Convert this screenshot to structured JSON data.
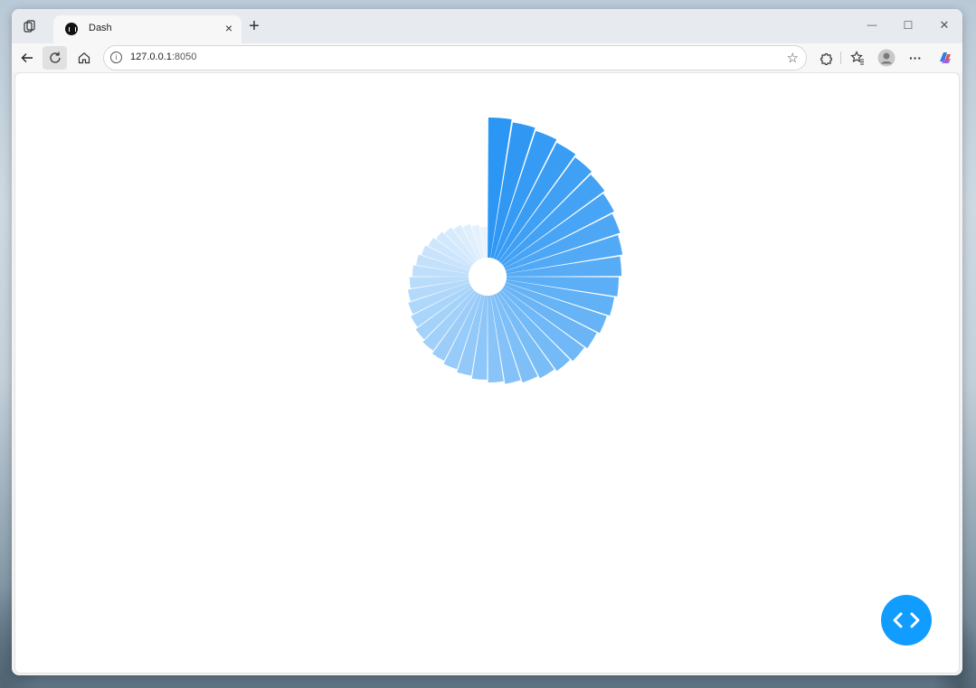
{
  "browser": {
    "tab": {
      "title": "Dash",
      "close_symbol": "×",
      "favicon": "dash-logo-icon"
    },
    "new_tab_symbol": "+",
    "window_controls": {
      "minimize": "—",
      "maximize": "☐",
      "close": "✕"
    },
    "address": {
      "host": "127.0.0.1",
      "port": ":8050"
    },
    "icons": [
      "workspaces-icon",
      "back-arrow-icon",
      "refresh-icon",
      "home-icon",
      "info-icon",
      "star-icon",
      "extensions-icon",
      "favorites-icon",
      "profile-avatar-icon",
      "more-icon",
      "copilot-icon"
    ]
  },
  "app": {
    "debug_button_icon": "code-brackets-icon",
    "accent": "#119dff"
  },
  "chart_data": {
    "type": "bar",
    "subtype": "polar-bar",
    "title": "",
    "angular_direction": "clockwise",
    "start_angle_deg": 90,
    "n_bars": 40,
    "radial_range": [
      0,
      100
    ],
    "hole": 0.12,
    "showlegend": false,
    "angular_axis_visible": false,
    "radial_axis_visible": false,
    "values": [
      100,
      98,
      96,
      94,
      92,
      90,
      88,
      86,
      84,
      82,
      80,
      78,
      76,
      74,
      72,
      70,
      68,
      66,
      64,
      62,
      60,
      58,
      56,
      54,
      52,
      50,
      48,
      46,
      44,
      42,
      40,
      38,
      36,
      34,
      32,
      30,
      28,
      26,
      24,
      22
    ],
    "color_start": "#2b96f3",
    "color_end": "#eaf4fd"
  }
}
